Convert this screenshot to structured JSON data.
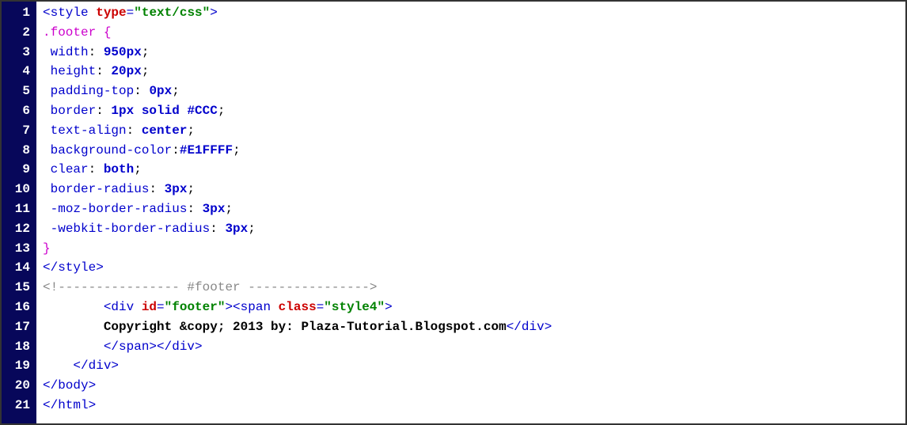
{
  "editor": {
    "line_count": 21,
    "lines": {
      "1": {
        "tokens": [
          {
            "cls": "tok-tag",
            "t": "<style "
          },
          {
            "cls": "tok-attr",
            "t": "type"
          },
          {
            "cls": "tok-tag",
            "t": "="
          },
          {
            "cls": "tok-str",
            "t": "\"text/css\""
          },
          {
            "cls": "tok-tag",
            "t": ">"
          }
        ]
      },
      "2": {
        "tokens": [
          {
            "cls": "tok-sel",
            "t": ".footer {"
          }
        ]
      },
      "3": {
        "tokens": [
          {
            "cls": "tok-punct",
            "t": " "
          },
          {
            "cls": "tok-prop",
            "t": "width"
          },
          {
            "cls": "tok-punct",
            "t": ": "
          },
          {
            "cls": "tok-val",
            "t": "950px"
          },
          {
            "cls": "tok-punct",
            "t": ";"
          }
        ]
      },
      "4": {
        "tokens": [
          {
            "cls": "tok-punct",
            "t": " "
          },
          {
            "cls": "tok-prop",
            "t": "height"
          },
          {
            "cls": "tok-punct",
            "t": ": "
          },
          {
            "cls": "tok-val",
            "t": "20px"
          },
          {
            "cls": "tok-punct",
            "t": ";"
          }
        ]
      },
      "5": {
        "tokens": [
          {
            "cls": "tok-punct",
            "t": " "
          },
          {
            "cls": "tok-prop",
            "t": "padding-top"
          },
          {
            "cls": "tok-punct",
            "t": ": "
          },
          {
            "cls": "tok-val",
            "t": "0px"
          },
          {
            "cls": "tok-punct",
            "t": ";"
          }
        ]
      },
      "6": {
        "tokens": [
          {
            "cls": "tok-punct",
            "t": " "
          },
          {
            "cls": "tok-prop",
            "t": "border"
          },
          {
            "cls": "tok-punct",
            "t": ": "
          },
          {
            "cls": "tok-val",
            "t": "1px solid #CCC"
          },
          {
            "cls": "tok-punct",
            "t": ";"
          }
        ]
      },
      "7": {
        "tokens": [
          {
            "cls": "tok-punct",
            "t": " "
          },
          {
            "cls": "tok-prop",
            "t": "text-align"
          },
          {
            "cls": "tok-punct",
            "t": ": "
          },
          {
            "cls": "tok-val",
            "t": "center"
          },
          {
            "cls": "tok-punct",
            "t": ";"
          }
        ]
      },
      "8": {
        "tokens": [
          {
            "cls": "tok-punct",
            "t": " "
          },
          {
            "cls": "tok-prop",
            "t": "background-color"
          },
          {
            "cls": "tok-punct",
            "t": ":"
          },
          {
            "cls": "tok-val",
            "t": "#E1FFFF"
          },
          {
            "cls": "tok-punct",
            "t": ";"
          }
        ]
      },
      "9": {
        "tokens": [
          {
            "cls": "tok-punct",
            "t": " "
          },
          {
            "cls": "tok-prop",
            "t": "clear"
          },
          {
            "cls": "tok-punct",
            "t": ": "
          },
          {
            "cls": "tok-val",
            "t": "both"
          },
          {
            "cls": "tok-punct",
            "t": ";"
          }
        ]
      },
      "10": {
        "tokens": [
          {
            "cls": "tok-punct",
            "t": " "
          },
          {
            "cls": "tok-prop",
            "t": "border-radius"
          },
          {
            "cls": "tok-punct",
            "t": ": "
          },
          {
            "cls": "tok-val",
            "t": "3px"
          },
          {
            "cls": "tok-punct",
            "t": ";"
          }
        ]
      },
      "11": {
        "tokens": [
          {
            "cls": "tok-punct",
            "t": " "
          },
          {
            "cls": "tok-prop",
            "t": "-moz-border-radius"
          },
          {
            "cls": "tok-punct",
            "t": ": "
          },
          {
            "cls": "tok-val",
            "t": "3px"
          },
          {
            "cls": "tok-punct",
            "t": ";"
          }
        ]
      },
      "12": {
        "tokens": [
          {
            "cls": "tok-punct",
            "t": " "
          },
          {
            "cls": "tok-prop",
            "t": "-webkit-border-radius"
          },
          {
            "cls": "tok-punct",
            "t": ": "
          },
          {
            "cls": "tok-val",
            "t": "3px"
          },
          {
            "cls": "tok-punct",
            "t": ";"
          }
        ]
      },
      "13": {
        "tokens": [
          {
            "cls": "tok-sel",
            "t": "}"
          }
        ]
      },
      "14": {
        "tokens": [
          {
            "cls": "tok-tag",
            "t": "</style>"
          }
        ]
      },
      "15": {
        "tokens": [
          {
            "cls": "tok-cmt",
            "t": "<!---------------- #footer ---------------->"
          }
        ]
      },
      "16": {
        "indent": "        ",
        "tokens": [
          {
            "cls": "tok-tag",
            "t": "<div "
          },
          {
            "cls": "tok-attr",
            "t": "id"
          },
          {
            "cls": "tok-tag",
            "t": "="
          },
          {
            "cls": "tok-str",
            "t": "\"footer\""
          },
          {
            "cls": "tok-tag",
            "t": "><span "
          },
          {
            "cls": "tok-attr",
            "t": "class"
          },
          {
            "cls": "tok-tag",
            "t": "="
          },
          {
            "cls": "tok-str",
            "t": "\"style4\""
          },
          {
            "cls": "tok-tag",
            "t": ">"
          }
        ]
      },
      "17": {
        "indent": "        ",
        "tokens": [
          {
            "cls": "tok-text",
            "t": "Copyright &copy; 2013 by: Plaza-Tutorial.Blogspot.com"
          },
          {
            "cls": "tok-tag",
            "t": "</div>"
          }
        ]
      },
      "18": {
        "indent": "        ",
        "tokens": [
          {
            "cls": "tok-tag",
            "t": "</span></div>"
          }
        ]
      },
      "19": {
        "indent": "    ",
        "tokens": [
          {
            "cls": "tok-tag",
            "t": "</div>"
          }
        ]
      },
      "20": {
        "tokens": [
          {
            "cls": "tok-tag",
            "t": "</body>"
          }
        ]
      },
      "21": {
        "tokens": [
          {
            "cls": "tok-tag",
            "t": "</html>"
          }
        ]
      }
    }
  }
}
